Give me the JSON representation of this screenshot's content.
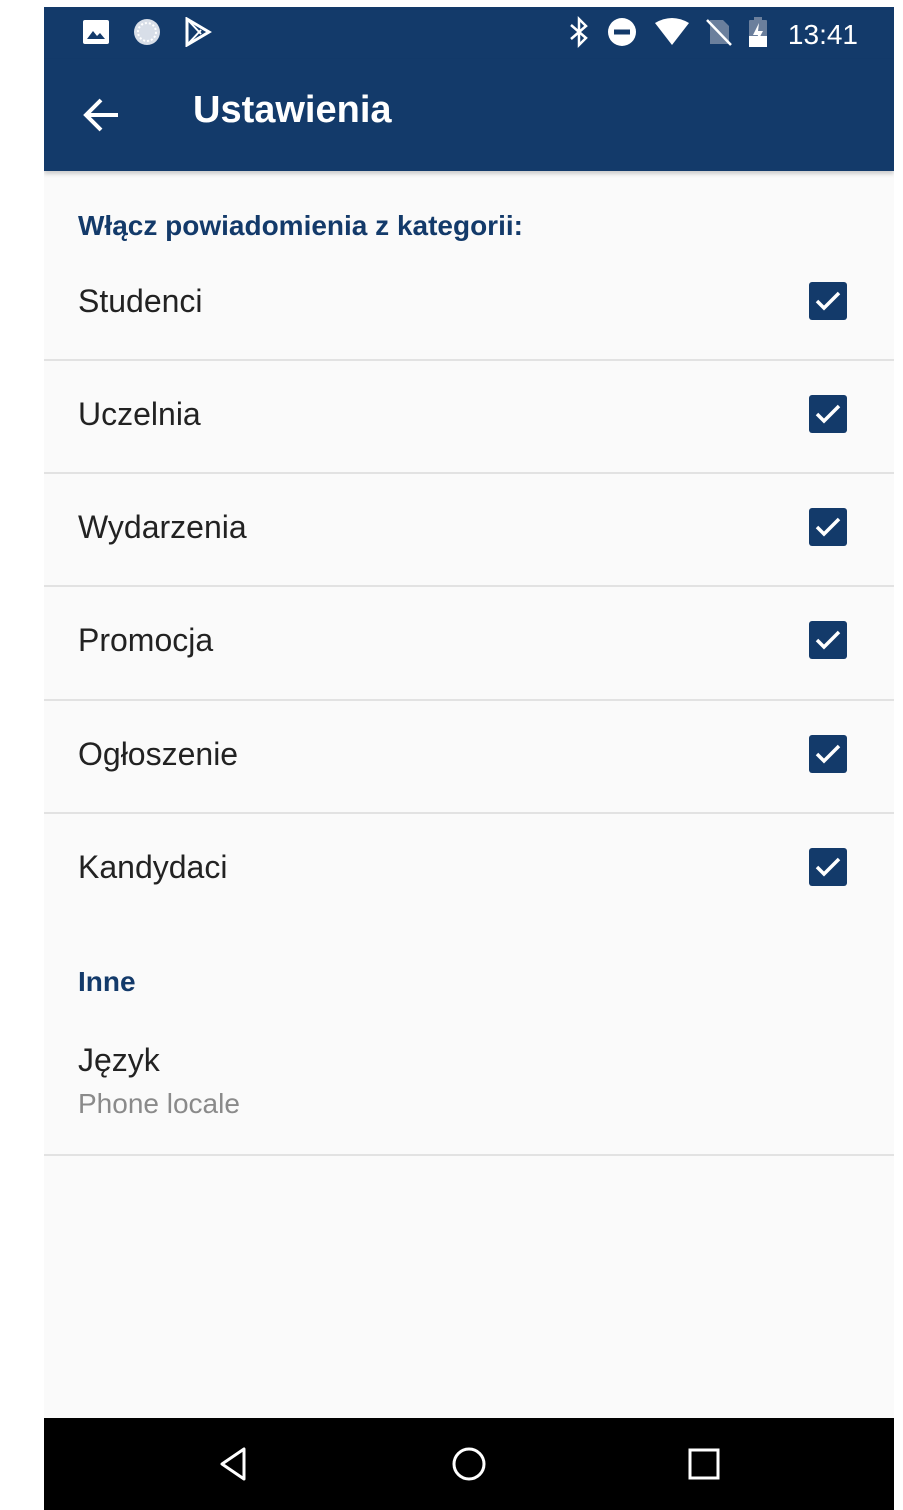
{
  "status_bar": {
    "time": "13:41",
    "left_icons": [
      "image-icon",
      "sync-circle-icon",
      "play-store-icon"
    ],
    "right_icons": [
      "bluetooth-icon",
      "do-not-disturb-icon",
      "wifi-icon",
      "no-sim-icon",
      "battery-charging-icon"
    ]
  },
  "app_bar": {
    "back_icon": "arrow-back-icon",
    "title": "Ustawienia"
  },
  "notifications": {
    "header": "Włącz powiadomienia z kategorii:",
    "items": [
      {
        "label": "Studenci",
        "checked": true
      },
      {
        "label": "Uczelnia",
        "checked": true
      },
      {
        "label": "Wydarzenia",
        "checked": true
      },
      {
        "label": "Promocja",
        "checked": true
      },
      {
        "label": "Ogłoszenie",
        "checked": true
      },
      {
        "label": "Kandydaci",
        "checked": true
      }
    ]
  },
  "other": {
    "header": "Inne",
    "language": {
      "title": "Język",
      "summary": "Phone locale"
    }
  },
  "nav_bar": {
    "buttons": [
      "back-triangle-icon",
      "home-circle-icon",
      "recents-square-icon"
    ]
  },
  "colors": {
    "primary": "#133a6a",
    "background": "#fafafa",
    "divider": "#e2e2e2",
    "secondary_text": "#8a8a8a"
  }
}
